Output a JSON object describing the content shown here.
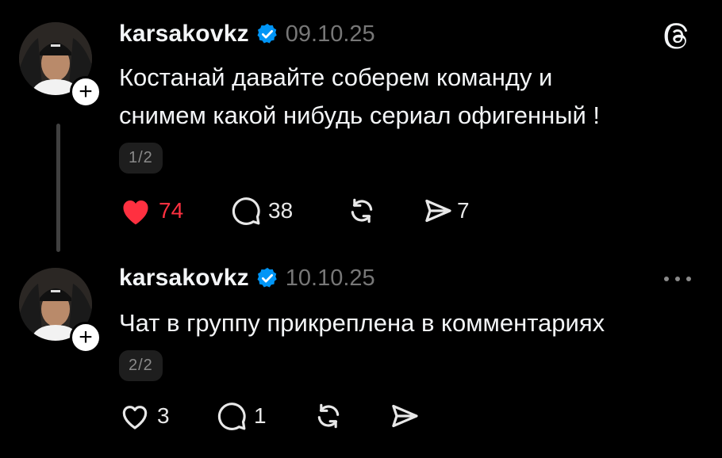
{
  "posts": [
    {
      "username": "karsakovkz",
      "date": "09.10.25",
      "text_lines": [
        "Костанай давайте соберем команду и",
        "снимем какой нибудь сериал офигенный !"
      ],
      "pager": "1/2",
      "likes": "74",
      "liked": true,
      "replies": "38",
      "shares": "7"
    },
    {
      "username": "karsakovkz",
      "date": "10.10.25",
      "text_lines": [
        "Чат в группу прикреплена в комментариях"
      ],
      "pager": "2/2",
      "likes": "3",
      "liked": false,
      "replies": "1"
    }
  ],
  "icons": {
    "verified": "verified-badge-icon",
    "app_logo": "threads-logo-icon",
    "more": "more-options-icon"
  },
  "colors": {
    "like_active": "#ff3040",
    "verified": "#0095f6",
    "background": "#000000"
  }
}
